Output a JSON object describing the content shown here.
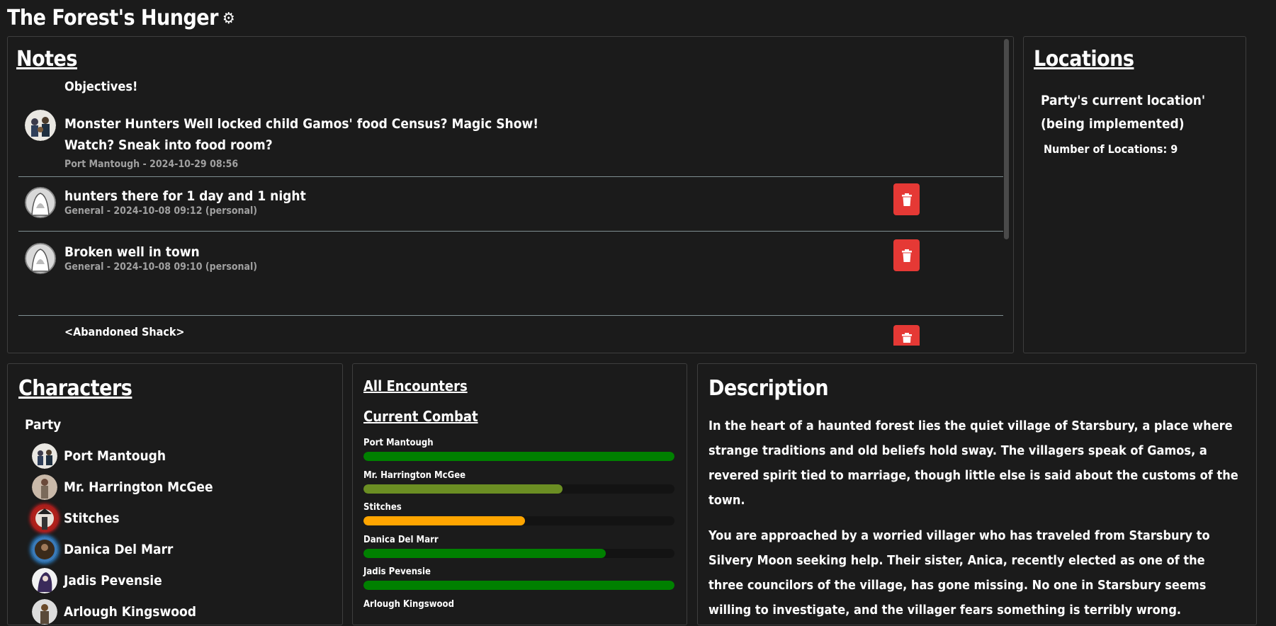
{
  "app": {
    "title": "The Forest's Hunger",
    "settings_icon": "gear-icon"
  },
  "notes": {
    "heading": "Notes",
    "items": [
      {
        "title": "Objectives!",
        "text": "Monster Hunters Well locked child Gamos' food Census? Magic Show! Watch? Sneak into food room?",
        "meta": "Port Mantough - 2024-10-29 08:56",
        "avatar": "party-avatar-icon"
      },
      {
        "text": "hunters there for 1 day and 1 night",
        "meta": "General - 2024-10-08 09:12 (personal)",
        "avatar": "hooded-figure-icon",
        "delete_icon": "trash-icon"
      },
      {
        "text": "Broken well in town",
        "meta": "General - 2024-10-08 09:10 (personal)",
        "avatar": "hooded-figure-icon",
        "delete_icon": "trash-icon"
      },
      {
        "text": "<Abandoned Shack>",
        "delete_icon": "trash-icon"
      }
    ]
  },
  "locations": {
    "heading": "Locations",
    "current_line1": "Party's current location'",
    "current_line2": "(being implemented)",
    "count_label": "Number of Locations: 9"
  },
  "characters": {
    "heading": "Characters",
    "group": "Party",
    "items": [
      {
        "name": "Port Mantough"
      },
      {
        "name": "Mr. Harrington McGee"
      },
      {
        "name": "Stitches"
      },
      {
        "name": "Danica Del Marr"
      },
      {
        "name": "Jadis Pevensie"
      },
      {
        "name": "Arlough Kingswood"
      }
    ]
  },
  "encounters": {
    "all_link": "All Encounters",
    "current_link": "Current Combat",
    "combatants": [
      {
        "name": "Port Mantough",
        "hp_fraction": 1.0,
        "color": "#008000"
      },
      {
        "name": "Mr. Harrington McGee",
        "hp_fraction": 0.64,
        "color": "#6b8e23"
      },
      {
        "name": "Stitches",
        "hp_fraction": 0.52,
        "color": "#ffa500"
      },
      {
        "name": "Danica Del Marr",
        "hp_fraction": 0.78,
        "color": "#008000"
      },
      {
        "name": "Jadis Pevensie",
        "hp_fraction": 1.0,
        "color": "#008000"
      },
      {
        "name": "Arlough Kingswood"
      }
    ]
  },
  "description": {
    "heading": "Description",
    "p1": "In the heart of a haunted forest lies the quiet village of Starsbury, a place where strange traditions and old beliefs hold sway. The villagers speak of Gamos, a revered spirit tied to marriage, though little else is said about the customs of the town.",
    "p2": "You are approached by a worried villager who has traveled from Starsbury to Silvery Moon seeking help. Their sister, Anica, recently elected as one of the three councilors of the village, has gone missing. No one in Starsbury seems willing to investigate, and the villager fears something is terribly wrong."
  },
  "colors": {
    "background": "#1b1b1b",
    "delete_button": "#e53935",
    "separator": "#7f8f92",
    "muted_text": "#a0a0a0"
  }
}
